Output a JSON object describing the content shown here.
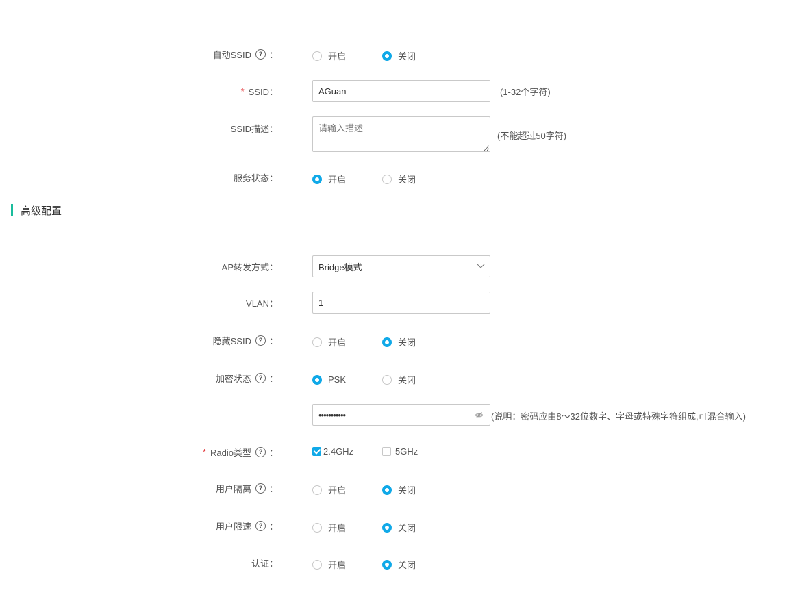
{
  "basic": {
    "auto_ssid": {
      "label": "自动SSID",
      "help": "?",
      "options": [
        "开启",
        "关闭"
      ],
      "selected": 1
    },
    "ssid": {
      "label": "SSID：",
      "required_mark": "*",
      "value": "AGuan",
      "hint": "(1-32个字符)"
    },
    "ssid_desc": {
      "label": "SSID描述：",
      "placeholder": "请输入描述",
      "hint": "(不能超过50字符)"
    },
    "service_status": {
      "label": "服务状态：",
      "options": [
        "开启",
        "关闭"
      ],
      "selected": 0
    }
  },
  "advanced": {
    "title": "高级配置",
    "forward_mode": {
      "label": "AP转发方式：",
      "value": "Bridge模式"
    },
    "vlan": {
      "label": "VLAN：",
      "value": "1"
    },
    "hide_ssid": {
      "label": "隐藏SSID",
      "help": "?",
      "options": [
        "开启",
        "关闭"
      ],
      "selected": 1
    },
    "encryption": {
      "label": "加密状态",
      "help": "?",
      "options": [
        "PSK",
        "关闭"
      ],
      "selected": 0
    },
    "password": {
      "value": "•••••••••••",
      "hint": "(说明：密码应由8～32位数字、字母或特殊字符组成,可混合输入)"
    },
    "radio_type": {
      "label": "Radio类型",
      "required_mark": "*",
      "help": "?",
      "options": [
        "2.4GHz",
        "5GHz"
      ],
      "checked": [
        true,
        false
      ]
    },
    "user_isolation": {
      "label": "用户隔离",
      "help": "?",
      "options": [
        "开启",
        "关闭"
      ],
      "selected": 1
    },
    "user_rate_limit": {
      "label": "用户限速",
      "help": "?",
      "options": [
        "开启",
        "关闭"
      ],
      "selected": 1
    },
    "auth": {
      "label": "认证：",
      "options": [
        "开启",
        "关闭"
      ],
      "selected": 1
    }
  },
  "colon": "："
}
